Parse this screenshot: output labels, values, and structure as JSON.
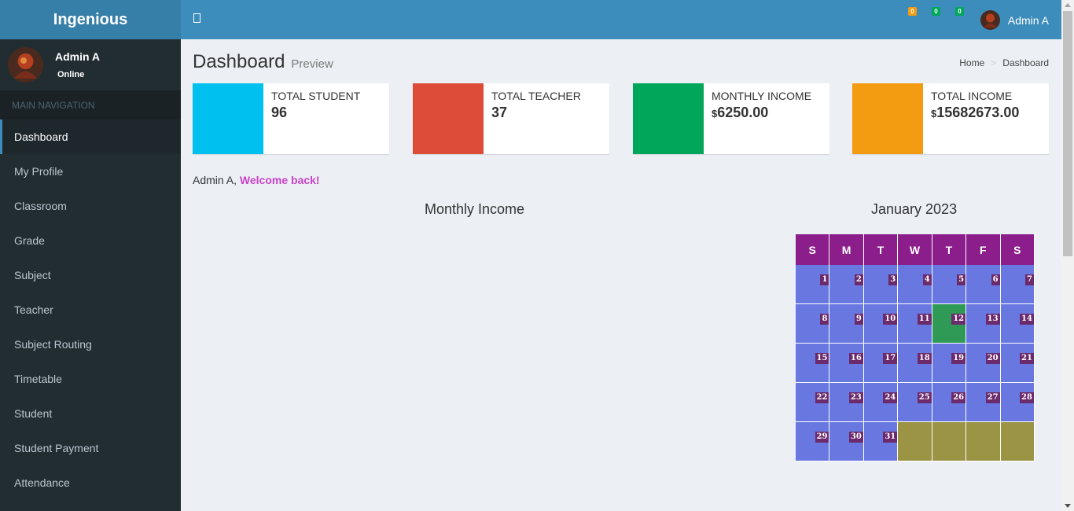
{
  "brand": "Ingenious",
  "user": {
    "name": "Admin A",
    "status": "Online"
  },
  "nav": {
    "header": "MAIN NAVIGATION",
    "items": [
      {
        "label": "Dashboard",
        "active": true
      },
      {
        "label": "My Profile"
      },
      {
        "label": "Classroom"
      },
      {
        "label": "Grade"
      },
      {
        "label": "Subject"
      },
      {
        "label": "Teacher"
      },
      {
        "label": "Subject Routing"
      },
      {
        "label": "Timetable"
      },
      {
        "label": "Student"
      },
      {
        "label": "Student Payment"
      },
      {
        "label": "Attendance"
      }
    ]
  },
  "header": {
    "badges": [
      {
        "count": "0",
        "color": "#f39c12"
      },
      {
        "count": "0",
        "color": "#00a65a"
      },
      {
        "count": "0",
        "color": "#00a65a"
      }
    ],
    "user_name": "Admin A"
  },
  "page": {
    "title": "Dashboard",
    "subtitle": "Preview"
  },
  "breadcrumb": {
    "home": "Home",
    "current": "Dashboard"
  },
  "stats": [
    {
      "label": "TOTAL STUDENT",
      "value": "96",
      "currency": "",
      "color": "#00c0ef"
    },
    {
      "label": "TOTAL TEACHER",
      "value": "37",
      "currency": "",
      "color": "#dd4b39"
    },
    {
      "label": "MONTHLY INCOME",
      "value": "6250.00",
      "currency": "$",
      "color": "#00a65a"
    },
    {
      "label": "TOTAL INCOME",
      "value": "15682673.00",
      "currency": "$",
      "color": "#f39c12"
    }
  ],
  "welcome": {
    "name": "Admin A,",
    "message": "Welcome back!"
  },
  "chart": {
    "title": "Monthly Income"
  },
  "calendar": {
    "title": "January 2023",
    "weekdays": [
      "S",
      "M",
      "T",
      "W",
      "T",
      "F",
      "S"
    ],
    "weeks": [
      [
        "1",
        "2",
        "3",
        "4",
        "5",
        "6",
        "7"
      ],
      [
        "8",
        "9",
        "10",
        "11",
        "12",
        "13",
        "14"
      ],
      [
        "15",
        "16",
        "17",
        "18",
        "19",
        "20",
        "21"
      ],
      [
        "22",
        "23",
        "24",
        "25",
        "26",
        "27",
        "28"
      ],
      [
        "29",
        "30",
        "31",
        "",
        "",
        "",
        ""
      ]
    ],
    "today": "12"
  }
}
